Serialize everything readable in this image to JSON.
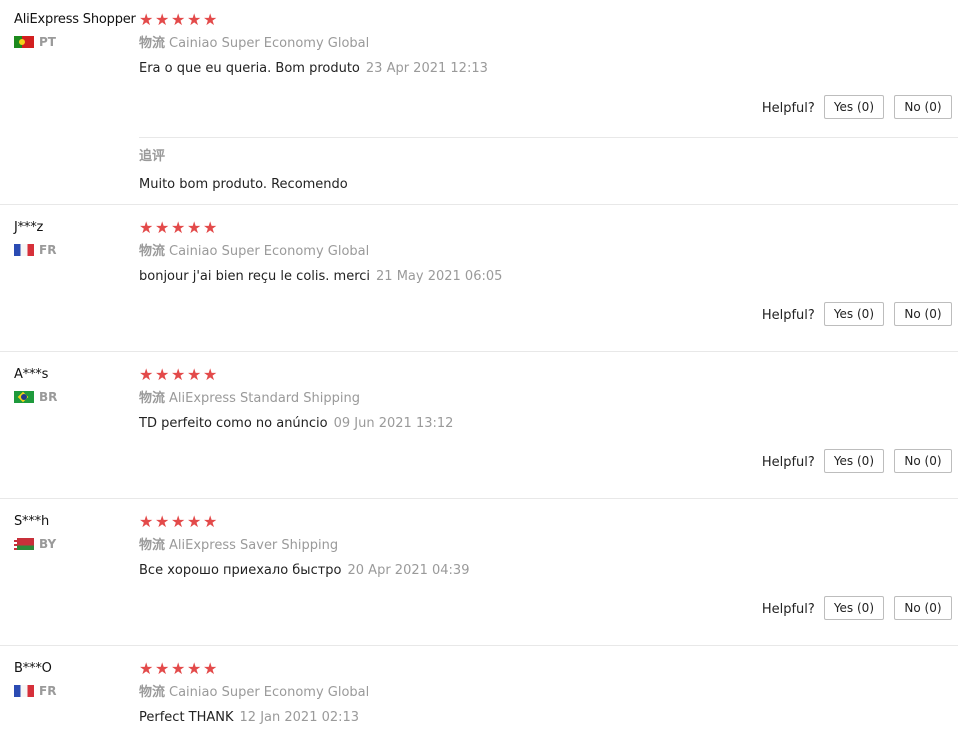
{
  "helpful_label": "Helpful?",
  "shipping_label": "物流",
  "colors": {
    "star": "#e34a4a",
    "muted_text": "#9a9a9a",
    "divider": "#e8e8e8"
  },
  "reviews": [
    {
      "user": "AliExpress Shopper",
      "country": "PT",
      "flag_icon": "portugal-flag-icon",
      "rating": 5,
      "shipping": "Cainiao Super Economy Global",
      "text": "Era o que eu queria. Bom produto",
      "date": "23 Apr 2021 12:13",
      "yes": "Yes (0)",
      "no": "No (0)",
      "additional": {
        "title": "追评",
        "text": "Muito bom produto. Recomendo"
      }
    },
    {
      "user": "J***z",
      "country": "FR",
      "flag_icon": "france-flag-icon",
      "rating": 5,
      "shipping": "Cainiao Super Economy Global",
      "text": "bonjour j'ai bien reçu le colis. merci",
      "date": "21 May 2021 06:05",
      "yes": "Yes (0)",
      "no": "No (0)"
    },
    {
      "user": "A***s",
      "country": "BR",
      "flag_icon": "brazil-flag-icon",
      "rating": 5,
      "shipping": "AliExpress Standard Shipping",
      "text": "TD perfeito como no anúncio",
      "date": "09 Jun 2021 13:12",
      "yes": "Yes (0)",
      "no": "No (0)"
    },
    {
      "user": "S***h",
      "country": "BY",
      "flag_icon": "belarus-flag-icon",
      "rating": 5,
      "shipping": "AliExpress Saver Shipping",
      "text": "Все хорошо приехало быстро",
      "date": "20 Apr 2021 04:39",
      "yes": "Yes (0)",
      "no": "No (0)"
    },
    {
      "user": "B***O",
      "country": "FR",
      "flag_icon": "france-flag-icon",
      "rating": 5,
      "shipping": "Cainiao Super Economy Global",
      "text": "Perfect THANK",
      "date": "12 Jan 2021 02:13"
    }
  ]
}
